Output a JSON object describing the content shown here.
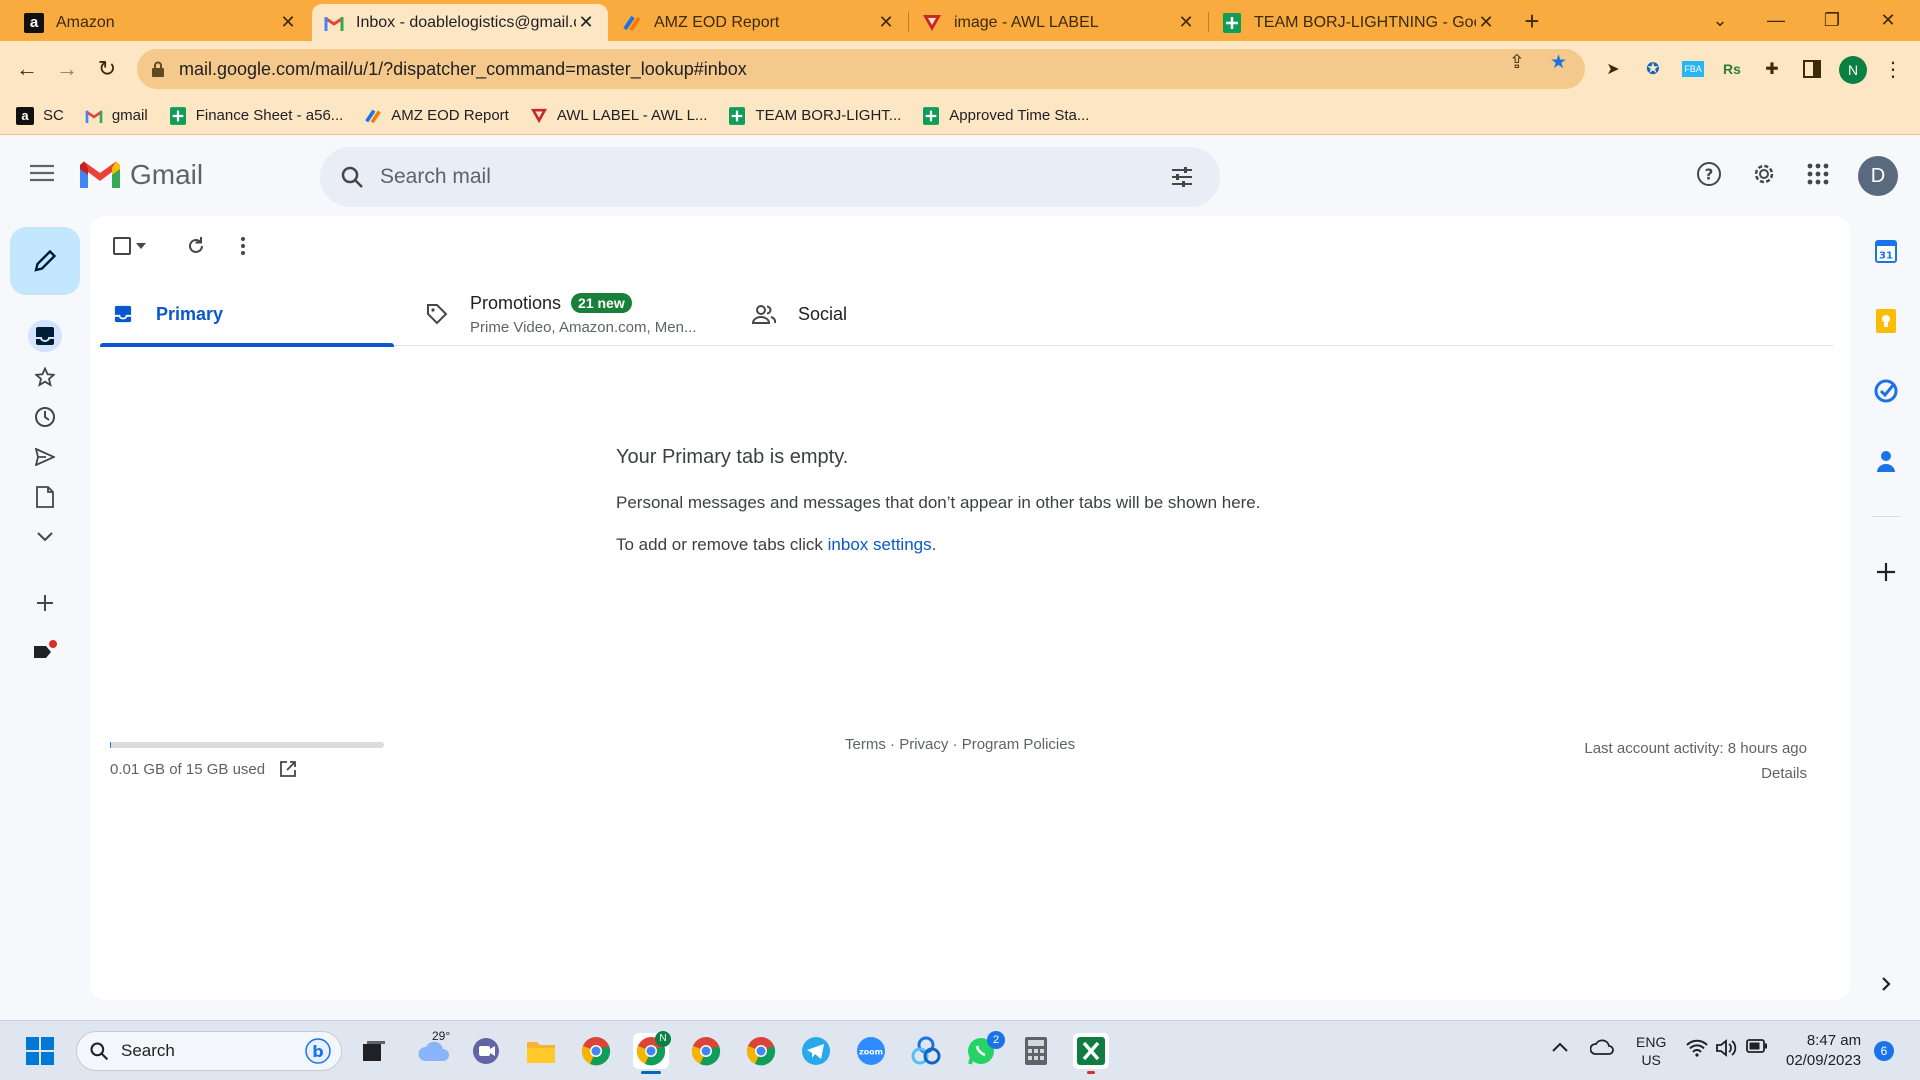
{
  "browser": {
    "tabs": [
      {
        "title": "Amazon",
        "favicon": "amazon-icon"
      },
      {
        "title": "Inbox - doablelogistics@gmail.com",
        "favicon": "gmail-icon"
      },
      {
        "title": "AMZ EOD Report",
        "favicon": "zoho-icon"
      },
      {
        "title": "image - AWL LABEL",
        "favicon": "awl-icon"
      },
      {
        "title": "TEAM BORJ-LIGHTNING - Google Sheets",
        "favicon": "sheets-icon"
      }
    ],
    "new_tab": "+",
    "url": "mail.google.com/mail/u/1/?dispatcher_command=master_lookup#inbox",
    "profile_initial": "N",
    "bookmarks": [
      {
        "label": "SC",
        "icon": "amazon-icon"
      },
      {
        "label": "gmail",
        "icon": "gmail-icon"
      },
      {
        "label": "Finance Sheet - a56...",
        "icon": "sheets-icon"
      },
      {
        "label": "AMZ EOD Report",
        "icon": "zoho-icon"
      },
      {
        "label": "AWL LABEL - AWL L...",
        "icon": "awl-icon"
      },
      {
        "label": "TEAM BORJ-LIGHT...",
        "icon": "sheets-icon"
      },
      {
        "label": "Approved Time Sta...",
        "icon": "sheets-icon"
      }
    ]
  },
  "gmail": {
    "wordmark": "Gmail",
    "search_placeholder": "Search mail",
    "avatar_initial": "D",
    "tabs": {
      "primary": "Primary",
      "promotions": "Promotions",
      "promotions_badge": "21 new",
      "promotions_sub": "Prime Video, Amazon.com, Men...",
      "social": "Social"
    },
    "empty": {
      "heading": "Your Primary tab is empty.",
      "line1": "Personal messages and messages that don’t appear in other tabs will be shown here.",
      "line2_prefix": "To add or remove tabs click ",
      "line2_link": "inbox settings",
      "line2_suffix": "."
    },
    "storage": {
      "text": "0.01 GB of 15 GB used",
      "used_fraction": 0.0007
    },
    "footer": {
      "terms": "Terms",
      "privacy": "Privacy",
      "program_policies": "Program Policies",
      "sep": " · "
    },
    "activity": {
      "last": "Last account activity: 8 hours ago",
      "details": "Details"
    }
  },
  "taskbar": {
    "search_placeholder": "Search",
    "weather_temp": "29°",
    "chrome_badge": "N",
    "whatsapp_badge": "2",
    "lang_top": "ENG",
    "lang_bottom": "US",
    "time": "8:47 am",
    "date": "02/09/2023",
    "notification_count": "6"
  },
  "colors": {
    "accent": "#0b57d0",
    "compose": "#c2e7ff",
    "chrome_frame": "#f9ab3f",
    "badge_green": "#188038"
  }
}
